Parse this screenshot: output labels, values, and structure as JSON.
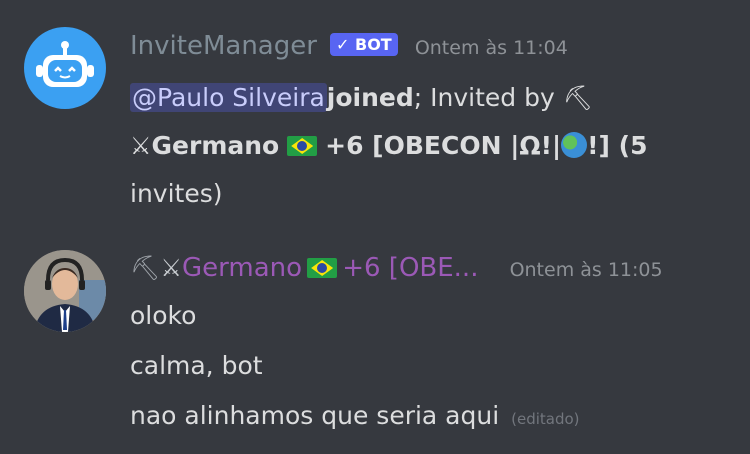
{
  "messages": [
    {
      "author": "InviteManager",
      "tag": "BOT",
      "timestamp": "Ontem às 11:04",
      "content": {
        "mention": "@Paulo Silveira",
        "action": "joined",
        "semicolon": ";",
        "invited_by": " Invited by",
        "name": "Germano",
        "bracket_text": "+6 [OBECON |Ω!|",
        "bracket_close": "!]",
        "invites": " (5",
        "invites_rest": "invites)"
      }
    },
    {
      "author": "Germano",
      "author_rest": "+6 [OBE...",
      "timestamp": "Ontem às 11:05",
      "lines": [
        "oloko",
        "calma, bot",
        "nao alinhamos que seria aqui"
      ],
      "edited_label": "(editado)"
    }
  ],
  "icons": [
    "robot-icon",
    "pick-icon",
    "crossed-swords-icon",
    "brazil-flag-icon",
    "globe-icon",
    "check-icon"
  ],
  "colors": {
    "background": "#36393f",
    "bot_tag": "#5865f2",
    "user_name": "#9b59b6",
    "mention_bg": "#5865f24d"
  }
}
